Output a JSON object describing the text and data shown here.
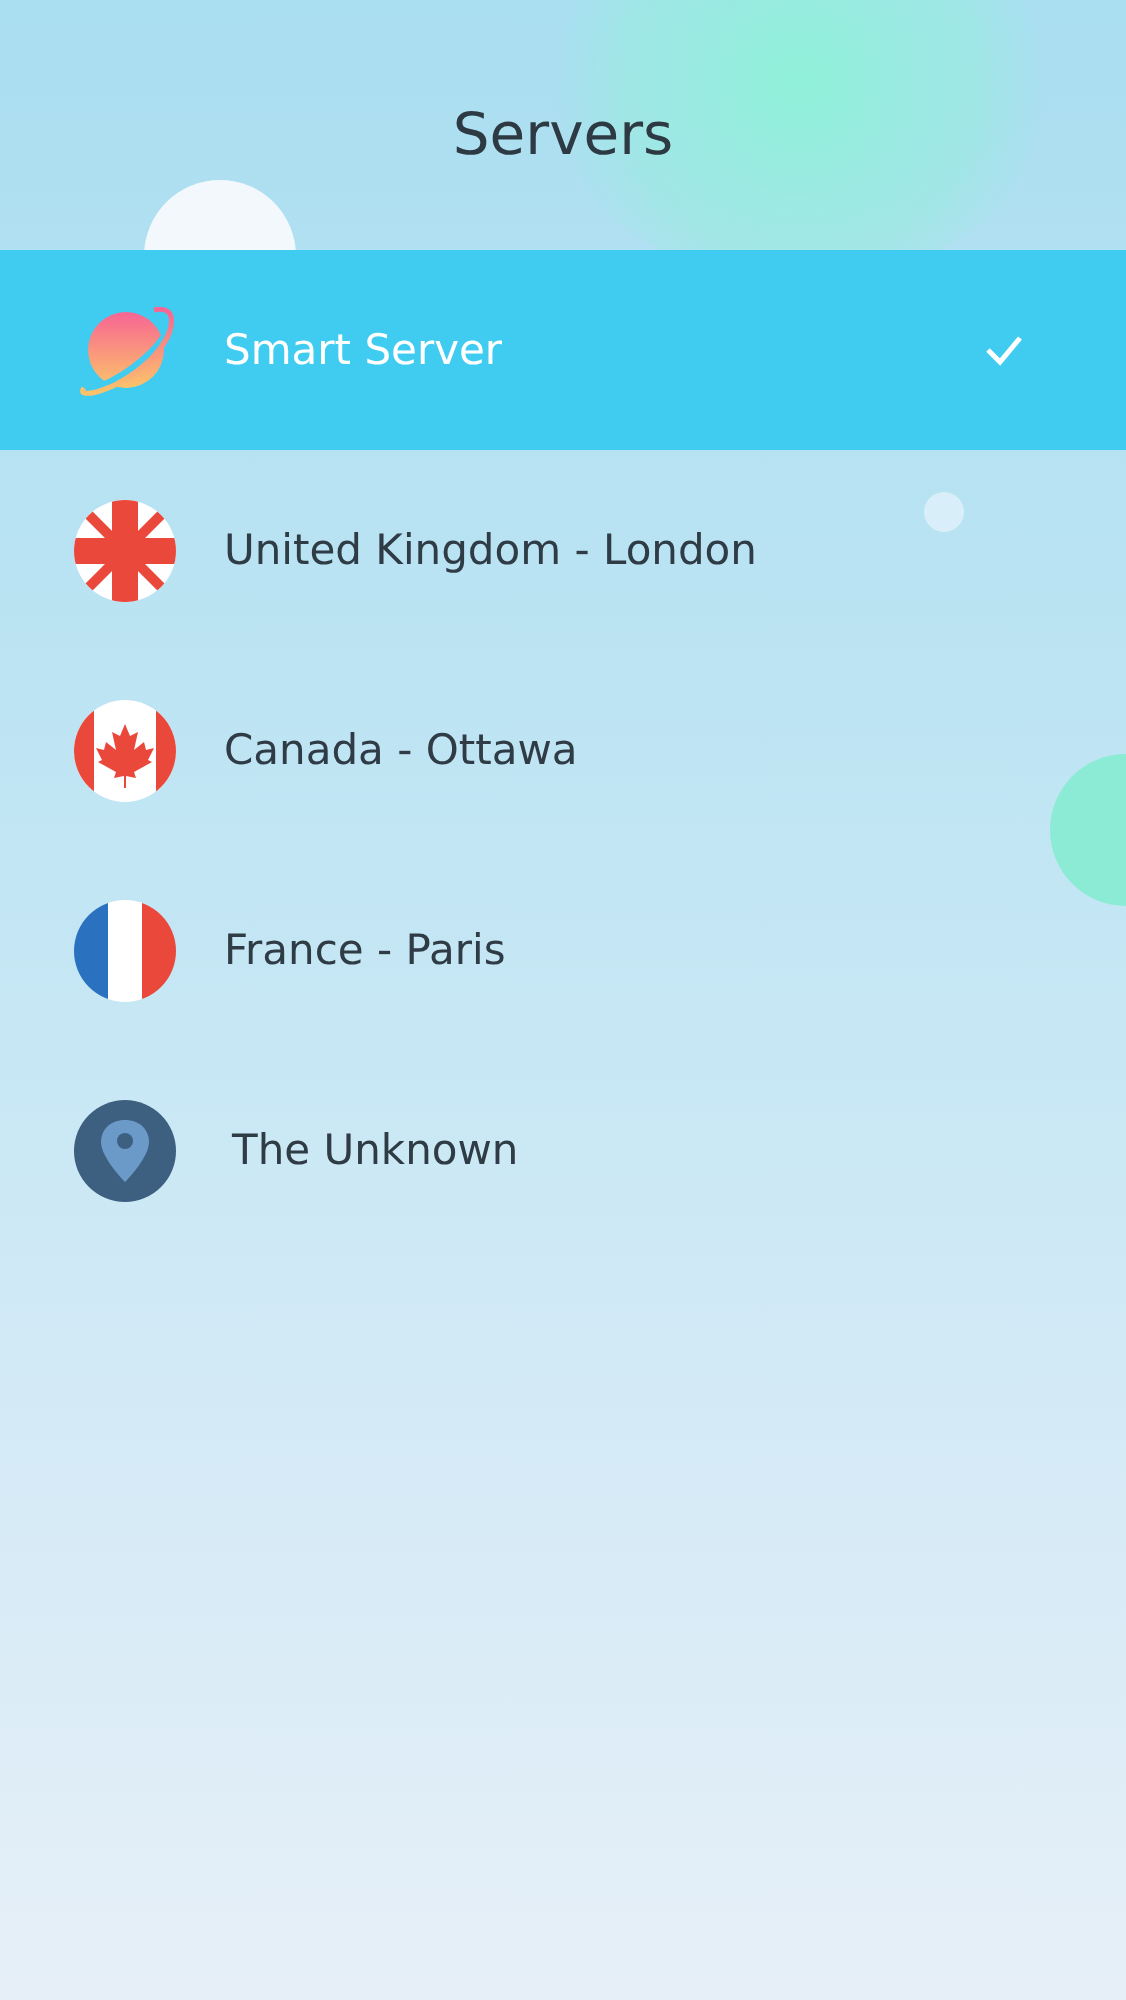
{
  "header": {
    "title": "Servers"
  },
  "servers": [
    {
      "name": "Smart Server",
      "kind": "planet",
      "selected": true
    },
    {
      "name": "United Kingdom - London",
      "kind": "uk",
      "selected": false
    },
    {
      "name": "Canada - Ottawa",
      "kind": "canada",
      "selected": false
    },
    {
      "name": "France - Paris",
      "kind": "france",
      "selected": false
    },
    {
      "name": "The Unknown",
      "kind": "pin",
      "selected": false
    }
  ]
}
